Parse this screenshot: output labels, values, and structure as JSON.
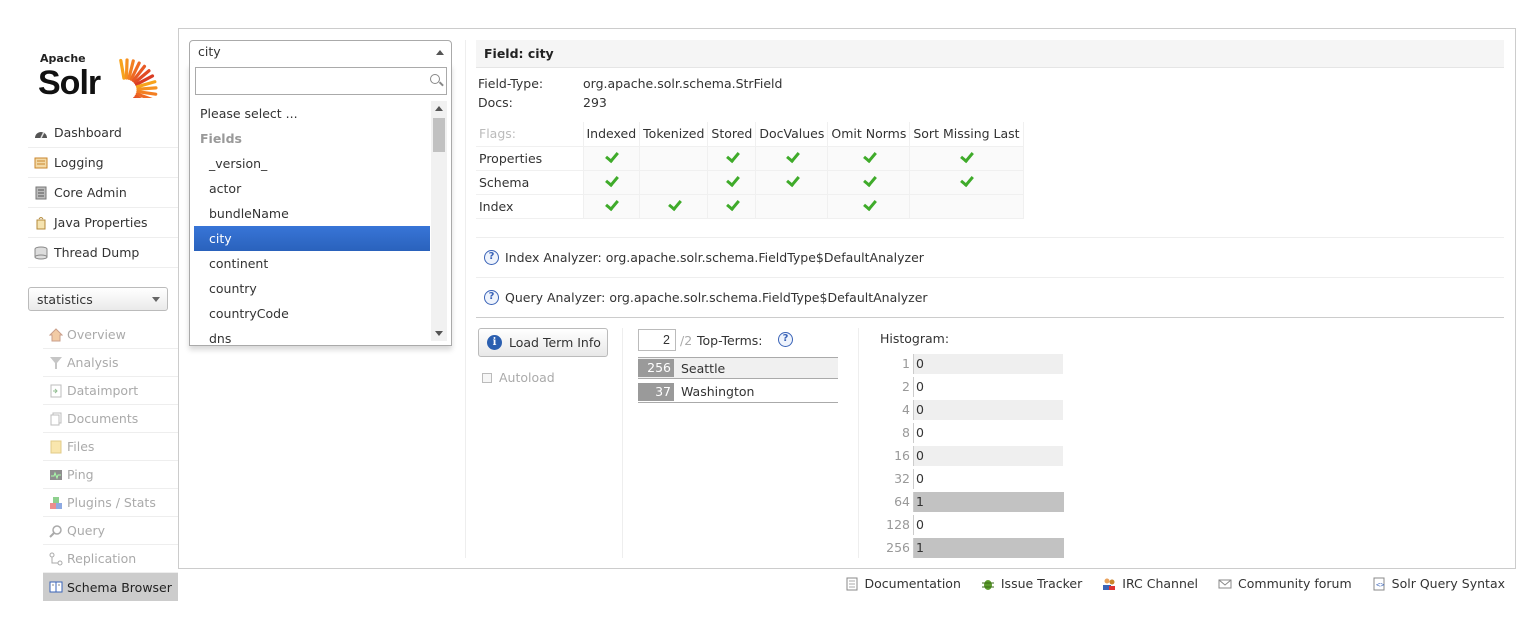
{
  "logo": {
    "apache": "Apache",
    "solr": "Solr"
  },
  "sidebar": {
    "items": [
      {
        "label": "Dashboard",
        "icon": "dashboard-icon"
      },
      {
        "label": "Logging",
        "icon": "logging-icon"
      },
      {
        "label": "Core Admin",
        "icon": "core-admin-icon"
      },
      {
        "label": "Java Properties",
        "icon": "java-properties-icon"
      },
      {
        "label": "Thread Dump",
        "icon": "thread-dump-icon"
      }
    ],
    "core_selector": "statistics",
    "core_items": [
      {
        "label": "Overview",
        "icon": "home-icon"
      },
      {
        "label": "Analysis",
        "icon": "funnel-icon"
      },
      {
        "label": "Dataimport",
        "icon": "dataimport-icon"
      },
      {
        "label": "Documents",
        "icon": "documents-icon"
      },
      {
        "label": "Files",
        "icon": "folder-icon"
      },
      {
        "label": "Ping",
        "icon": "ping-icon"
      },
      {
        "label": "Plugins / Stats",
        "icon": "plugins-icon"
      },
      {
        "label": "Query",
        "icon": "magnifier-icon"
      },
      {
        "label": "Replication",
        "icon": "replication-icon"
      },
      {
        "label": "Schema Browser",
        "icon": "schema-browser-icon",
        "active": true
      }
    ]
  },
  "field_select": {
    "value": "city",
    "search_placeholder": "",
    "options": [
      {
        "label": "Please select ...",
        "type": "option"
      },
      {
        "label": "Fields",
        "type": "group"
      },
      {
        "label": "_version_",
        "type": "child"
      },
      {
        "label": "actor",
        "type": "child"
      },
      {
        "label": "bundleName",
        "type": "child"
      },
      {
        "label": "city",
        "type": "child",
        "selected": true
      },
      {
        "label": "continent",
        "type": "child"
      },
      {
        "label": "country",
        "type": "child"
      },
      {
        "label": "countryCode",
        "type": "child"
      },
      {
        "label": "dns",
        "type": "child"
      }
    ]
  },
  "field": {
    "heading": "Field: city",
    "field_type_label": "Field-Type:",
    "field_type_value": "org.apache.solr.schema.StrField",
    "docs_label": "Docs:",
    "docs_value": "293"
  },
  "flags": {
    "header_label": "Flags:",
    "columns": [
      "Indexed",
      "Tokenized",
      "Stored",
      "DocValues",
      "Omit Norms",
      "Sort Missing Last"
    ],
    "rows": [
      {
        "label": "Properties",
        "values": [
          true,
          false,
          true,
          true,
          true,
          true
        ]
      },
      {
        "label": "Schema",
        "values": [
          true,
          false,
          true,
          true,
          true,
          true
        ]
      },
      {
        "label": "Index",
        "values": [
          true,
          true,
          true,
          false,
          true,
          false
        ]
      }
    ]
  },
  "analyzers": {
    "index_label": "Index Analyzer:",
    "index_value": "org.apache.solr.schema.FieldType$DefaultAnalyzer",
    "query_label": "Query Analyzer:",
    "query_value": "org.apache.solr.schema.FieldType$DefaultAnalyzer",
    "help_glyph": "?"
  },
  "term_info": {
    "load_button": "Load Term Info",
    "info_glyph": "i",
    "autoload_label": "Autoload",
    "topn_value": "2",
    "topn_of": "/2",
    "top_terms_label": "Top-Terms:",
    "top_terms": [
      {
        "count": "256",
        "term": "Seattle"
      },
      {
        "count": "37",
        "term": "Washington"
      }
    ],
    "histogram_label": "Histogram:",
    "histogram": [
      {
        "key": "1",
        "value": "0",
        "fill": 0
      },
      {
        "key": "2",
        "value": "0",
        "fill": 0
      },
      {
        "key": "4",
        "value": "0",
        "fill": 0
      },
      {
        "key": "8",
        "value": "0",
        "fill": 0
      },
      {
        "key": "16",
        "value": "0",
        "fill": 0
      },
      {
        "key": "32",
        "value": "0",
        "fill": 0
      },
      {
        "key": "64",
        "value": "1",
        "fill": 1
      },
      {
        "key": "128",
        "value": "0",
        "fill": 0
      },
      {
        "key": "256",
        "value": "1",
        "fill": 1
      }
    ]
  },
  "footer": {
    "links": [
      {
        "label": "Documentation",
        "icon": "documentation-icon"
      },
      {
        "label": "Issue Tracker",
        "icon": "bug-icon"
      },
      {
        "label": "IRC Channel",
        "icon": "irc-people-icon"
      },
      {
        "label": "Community forum",
        "icon": "envelope-icon"
      },
      {
        "label": "Solr Query Syntax",
        "icon": "query-syntax-icon"
      }
    ]
  },
  "colors": {
    "accent": "#3875d7",
    "check": "#3fab2a",
    "bar": "#c2c2c2"
  }
}
